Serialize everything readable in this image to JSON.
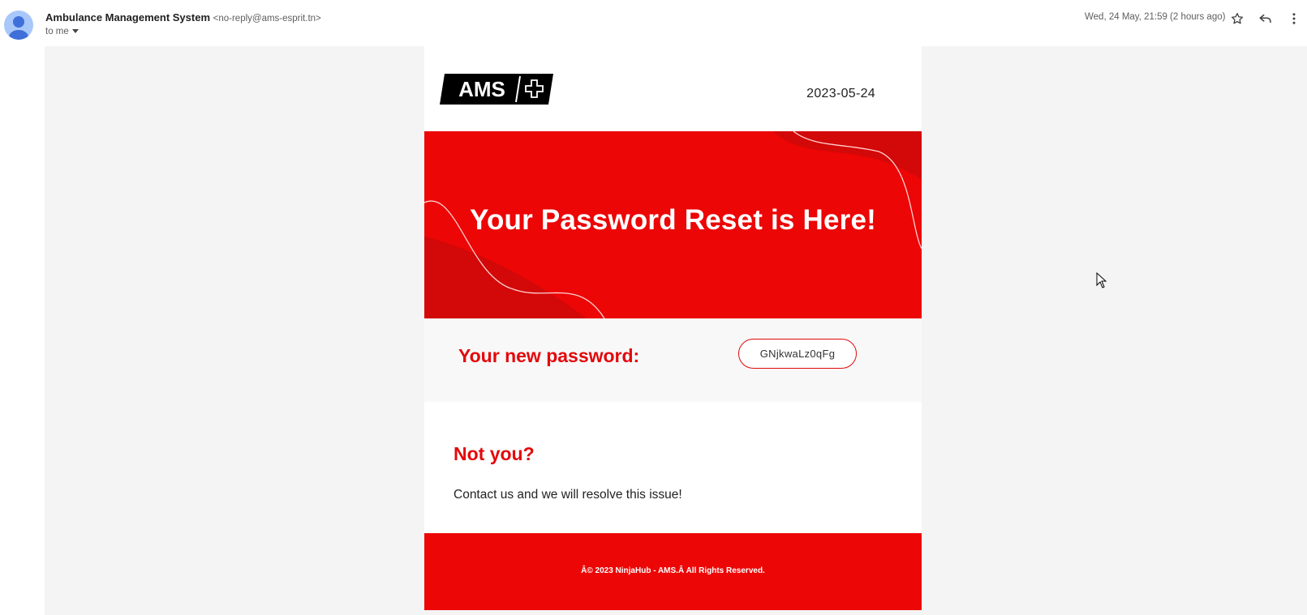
{
  "header": {
    "sender_name": "Ambulance Management System",
    "sender_email": "<no-reply@ams-esprit.tn>",
    "to_label": "to me",
    "date": "Wed, 24 May, 21:59 (2 hours ago)",
    "icons": [
      "person-avatar-icon",
      "star-icon",
      "reply-icon",
      "more-vert-icon"
    ]
  },
  "email": {
    "logo_text": "AMS",
    "date": "2023-05-24",
    "banner_title": "Your Password Reset is Here!",
    "password_label": "Your new password:",
    "password_value": "GNjkwaLz0qFg",
    "not_you_title": "Not you?",
    "contact_text": "Contact us and we will resolve this issue!",
    "footer_text": "Â© 2023 NinjaHub - AMS.Â  All Rights Reserved."
  },
  "colors": {
    "brand_red": "#ec0606",
    "accent_red": "#e3080b",
    "background": "#f4f4f4"
  }
}
